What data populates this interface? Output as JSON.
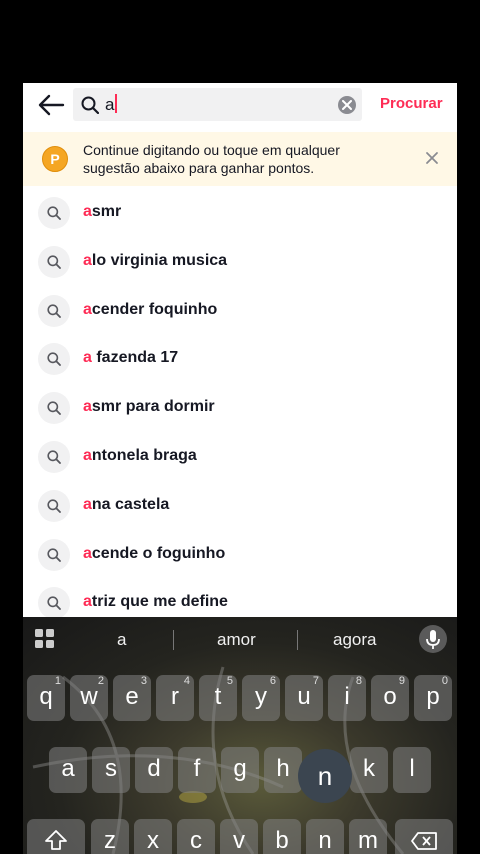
{
  "search": {
    "value": "a",
    "submit_label": "Procurar"
  },
  "banner": {
    "coin_letter": "P",
    "message": "Continue digitando ou toque em qualquer sugestão abaixo para ganhar pontos."
  },
  "suggestions": [
    {
      "prefix": "a",
      "rest": "smr"
    },
    {
      "prefix": "a",
      "rest": "lo virginia musica"
    },
    {
      "prefix": "a",
      "rest": "cender foquinho"
    },
    {
      "prefix": "a",
      "rest": " fazenda 17"
    },
    {
      "prefix": "a",
      "rest": "smr para dormir"
    },
    {
      "prefix": "a",
      "rest": "ntonela braga"
    },
    {
      "prefix": "a",
      "rest": "na castela"
    },
    {
      "prefix": "a",
      "rest": "cende o foguinho"
    },
    {
      "prefix": "a",
      "rest": "triz que me define"
    }
  ],
  "keyboard": {
    "word_suggestions": [
      "a",
      "amor",
      "agora"
    ],
    "row1": [
      {
        "key": "q",
        "num": "1"
      },
      {
        "key": "w",
        "num": "2"
      },
      {
        "key": "e",
        "num": "3"
      },
      {
        "key": "r",
        "num": "4"
      },
      {
        "key": "t",
        "num": "5"
      },
      {
        "key": "y",
        "num": "6"
      },
      {
        "key": "u",
        "num": "7"
      },
      {
        "key": "i",
        "num": "8"
      },
      {
        "key": "o",
        "num": "9"
      },
      {
        "key": "p",
        "num": "0"
      }
    ],
    "row2": [
      "a",
      "s",
      "d",
      "f",
      "g",
      "h",
      "j",
      "k",
      "l"
    ],
    "pressed_key": "n",
    "row3": [
      "z",
      "x",
      "c",
      "v",
      "b",
      "n",
      "m"
    ]
  },
  "colors": {
    "accent": "#fe2c55",
    "banner_bg": "#fff8e6",
    "coin": "#f5a623"
  }
}
